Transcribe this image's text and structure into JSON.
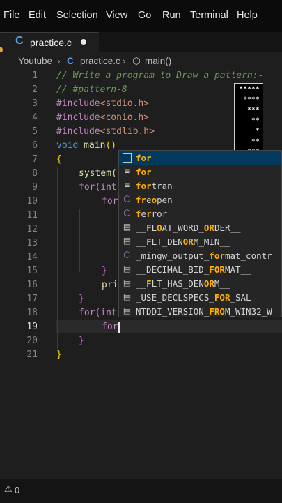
{
  "menu": [
    "File",
    "Edit",
    "Selection",
    "View",
    "Go",
    "Run",
    "Terminal",
    "Help"
  ],
  "tab": {
    "icon": "C",
    "label": "practice.c"
  },
  "breadcrumb": {
    "folder": "Youtube",
    "file_icon": "C",
    "file": "practice.c",
    "symbol": "main()"
  },
  "line_numbers": [
    "1",
    "2",
    "3",
    "4",
    "5",
    "6",
    "7",
    "8",
    "9",
    "10",
    "11",
    "12",
    "13",
    "14",
    "15",
    "16",
    "17",
    "18",
    "19",
    "20",
    "21"
  ],
  "code": {
    "l1": "// Write a program to Draw a pattern:-",
    "l2": "// #pattern-8",
    "inc_kw": "#include",
    "l3": "<stdio.h>",
    "l4": "<conio.h>",
    "l5": "<stdlib.h>",
    "void": "void",
    "main": "main",
    "parens": "()",
    "open_brace": "{",
    "close_brace": "}",
    "system": "system(",
    "for_int": "for(int",
    "for_kw": "for",
    "pri": "pri",
    "typing": "for"
  },
  "pattern_rows": [
    "*****",
    "****",
    "***",
    "**",
    "*",
    "**",
    "***",
    "****",
    "*****"
  ],
  "suggestions": [
    {
      "kind": "keyword",
      "pre": "",
      "hl": "for",
      "post": ""
    },
    {
      "kind": "snippet",
      "pre": "",
      "hl": "for",
      "post": ""
    },
    {
      "kind": "snippet",
      "pre": "",
      "hl": "for",
      "post": "tran"
    },
    {
      "kind": "function",
      "pre": "",
      "hl": "fr",
      "mid": "e",
      "hl2": "o",
      "post": "pen"
    },
    {
      "kind": "function",
      "pre": "",
      "hl": "f",
      "mid": "e",
      "hl2": "r",
      "post": "ror"
    },
    {
      "kind": "constant",
      "pre": "__",
      "hl": "F",
      "mid": "L",
      "hl2": "O",
      "mid2": "AT_WORD_",
      "hl3": "OR",
      "post": "DER__"
    },
    {
      "kind": "constant",
      "pre": "__",
      "hl": "F",
      "mid": "LT_DEN",
      "hl2": "OR",
      "post": "M_MIN__"
    },
    {
      "kind": "function",
      "pre": "_mingw_output_",
      "hl": "for",
      "post": "mat_contr"
    },
    {
      "kind": "constant",
      "pre": "__DECIMAL_BID_",
      "hl": "FOR",
      "post": "MAT__"
    },
    {
      "kind": "constant",
      "pre": "__",
      "hl": "F",
      "mid": "LT_HAS_DEN",
      "hl2": "OR",
      "post": "M__"
    },
    {
      "kind": "constant",
      "pre": "_USE_DECLSPECS_",
      "hl": "FOR",
      "post": "_SAL"
    },
    {
      "kind": "constant",
      "pre": "NTDDI_VERSION_",
      "hl": "FR",
      "mid": "",
      "hl2": "O",
      "post": "M_WIN32_W"
    }
  ],
  "status": {
    "problems_icon": "warning-icon",
    "problems_count": "0"
  },
  "colors": {
    "accent_tab_icon": "#5aa4e8",
    "match_highlight": "#ffb000",
    "comment": "#6a9955"
  }
}
